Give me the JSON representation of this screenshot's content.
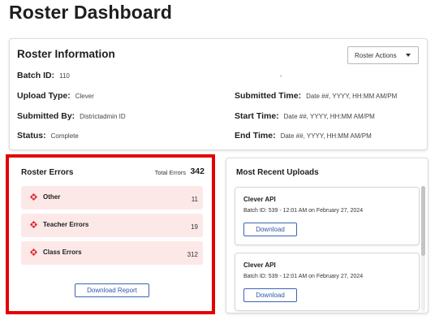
{
  "page": {
    "title": "Roster Dashboard"
  },
  "roster_info": {
    "title": "Roster Information",
    "actions_label": "Roster Actions",
    "batch_id_label": "Batch ID:",
    "batch_id_value": "110",
    "separator": "-",
    "upload_type_label": "Upload Type:",
    "upload_type_value": "Clever",
    "submitted_by_label": "Submitted By:",
    "submitted_by_value": "Districtadmin ID",
    "status_label": "Status:",
    "status_value": "Complete",
    "submitted_time_label": "Submitted Time:",
    "submitted_time_value": "Date ##, YYYY, HH:MM AM/PM",
    "start_time_label": "Start Time:",
    "start_time_value": "Date ##, YYYY, HH:MM AM/PM",
    "end_time_label": "End Time:",
    "end_time_value": "Date ##, YYYY, HH:MM AM/PM"
  },
  "roster_errors": {
    "title": "Roster Errors",
    "total_label": "Total Errors",
    "total_value": "342",
    "items": [
      {
        "label": "Other",
        "count": "11"
      },
      {
        "label": "Teacher Errors",
        "count": "19"
      },
      {
        "label": "Class Errors",
        "count": "312"
      }
    ],
    "download_label": "Download Report",
    "icon": "error-diamond-icon",
    "icon_color": "#e0242e",
    "highlight_color": "#e30000"
  },
  "recent_uploads": {
    "title": "Most Recent Uploads",
    "items": [
      {
        "name": "Clever API",
        "batch": "Batch ID: 539 - 12:01 AM on February 27, 2024",
        "download_label": "Download"
      },
      {
        "name": "Clever API",
        "batch": "Batch ID: 539 - 12:01 AM on February 27, 2024",
        "download_label": "Download"
      }
    ]
  },
  "colors": {
    "accent": "#2f57a8",
    "error_bg": "#fde8e8"
  }
}
